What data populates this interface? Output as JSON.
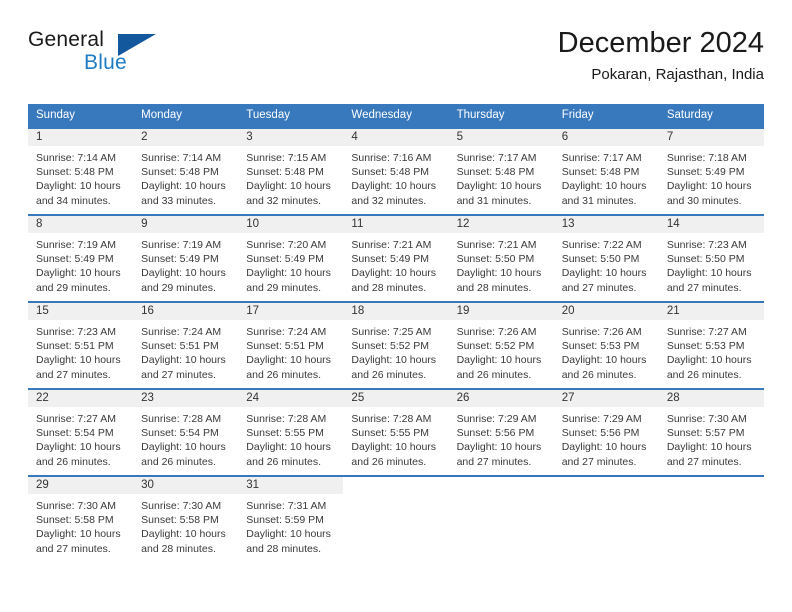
{
  "brand": {
    "word1": "General",
    "word2": "Blue",
    "flag_icon": "flag-triangle-icon",
    "blue_hex": "#1f7cc4",
    "dark_blue_hex": "#13589c"
  },
  "header": {
    "title": "December 2024",
    "subtitle": "Pokaran, Rajasthan, India"
  },
  "theme": {
    "header_blue": "#3878bd",
    "day_band_gray": "#f0f0f0",
    "text": "#3a3a3a"
  },
  "weekdays": [
    "Sunday",
    "Monday",
    "Tuesday",
    "Wednesday",
    "Thursday",
    "Friday",
    "Saturday"
  ],
  "weeks": [
    [
      {
        "day": "1",
        "sunrise": "Sunrise: 7:14 AM",
        "sunset": "Sunset: 5:48 PM",
        "daylight1": "Daylight: 10 hours",
        "daylight2": "and 34 minutes."
      },
      {
        "day": "2",
        "sunrise": "Sunrise: 7:14 AM",
        "sunset": "Sunset: 5:48 PM",
        "daylight1": "Daylight: 10 hours",
        "daylight2": "and 33 minutes."
      },
      {
        "day": "3",
        "sunrise": "Sunrise: 7:15 AM",
        "sunset": "Sunset: 5:48 PM",
        "daylight1": "Daylight: 10 hours",
        "daylight2": "and 32 minutes."
      },
      {
        "day": "4",
        "sunrise": "Sunrise: 7:16 AM",
        "sunset": "Sunset: 5:48 PM",
        "daylight1": "Daylight: 10 hours",
        "daylight2": "and 32 minutes."
      },
      {
        "day": "5",
        "sunrise": "Sunrise: 7:17 AM",
        "sunset": "Sunset: 5:48 PM",
        "daylight1": "Daylight: 10 hours",
        "daylight2": "and 31 minutes."
      },
      {
        "day": "6",
        "sunrise": "Sunrise: 7:17 AM",
        "sunset": "Sunset: 5:48 PM",
        "daylight1": "Daylight: 10 hours",
        "daylight2": "and 31 minutes."
      },
      {
        "day": "7",
        "sunrise": "Sunrise: 7:18 AM",
        "sunset": "Sunset: 5:49 PM",
        "daylight1": "Daylight: 10 hours",
        "daylight2": "and 30 minutes."
      }
    ],
    [
      {
        "day": "8",
        "sunrise": "Sunrise: 7:19 AM",
        "sunset": "Sunset: 5:49 PM",
        "daylight1": "Daylight: 10 hours",
        "daylight2": "and 29 minutes."
      },
      {
        "day": "9",
        "sunrise": "Sunrise: 7:19 AM",
        "sunset": "Sunset: 5:49 PM",
        "daylight1": "Daylight: 10 hours",
        "daylight2": "and 29 minutes."
      },
      {
        "day": "10",
        "sunrise": "Sunrise: 7:20 AM",
        "sunset": "Sunset: 5:49 PM",
        "daylight1": "Daylight: 10 hours",
        "daylight2": "and 29 minutes."
      },
      {
        "day": "11",
        "sunrise": "Sunrise: 7:21 AM",
        "sunset": "Sunset: 5:49 PM",
        "daylight1": "Daylight: 10 hours",
        "daylight2": "and 28 minutes."
      },
      {
        "day": "12",
        "sunrise": "Sunrise: 7:21 AM",
        "sunset": "Sunset: 5:50 PM",
        "daylight1": "Daylight: 10 hours",
        "daylight2": "and 28 minutes."
      },
      {
        "day": "13",
        "sunrise": "Sunrise: 7:22 AM",
        "sunset": "Sunset: 5:50 PM",
        "daylight1": "Daylight: 10 hours",
        "daylight2": "and 27 minutes."
      },
      {
        "day": "14",
        "sunrise": "Sunrise: 7:23 AM",
        "sunset": "Sunset: 5:50 PM",
        "daylight1": "Daylight: 10 hours",
        "daylight2": "and 27 minutes."
      }
    ],
    [
      {
        "day": "15",
        "sunrise": "Sunrise: 7:23 AM",
        "sunset": "Sunset: 5:51 PM",
        "daylight1": "Daylight: 10 hours",
        "daylight2": "and 27 minutes."
      },
      {
        "day": "16",
        "sunrise": "Sunrise: 7:24 AM",
        "sunset": "Sunset: 5:51 PM",
        "daylight1": "Daylight: 10 hours",
        "daylight2": "and 27 minutes."
      },
      {
        "day": "17",
        "sunrise": "Sunrise: 7:24 AM",
        "sunset": "Sunset: 5:51 PM",
        "daylight1": "Daylight: 10 hours",
        "daylight2": "and 26 minutes."
      },
      {
        "day": "18",
        "sunrise": "Sunrise: 7:25 AM",
        "sunset": "Sunset: 5:52 PM",
        "daylight1": "Daylight: 10 hours",
        "daylight2": "and 26 minutes."
      },
      {
        "day": "19",
        "sunrise": "Sunrise: 7:26 AM",
        "sunset": "Sunset: 5:52 PM",
        "daylight1": "Daylight: 10 hours",
        "daylight2": "and 26 minutes."
      },
      {
        "day": "20",
        "sunrise": "Sunrise: 7:26 AM",
        "sunset": "Sunset: 5:53 PM",
        "daylight1": "Daylight: 10 hours",
        "daylight2": "and 26 minutes."
      },
      {
        "day": "21",
        "sunrise": "Sunrise: 7:27 AM",
        "sunset": "Sunset: 5:53 PM",
        "daylight1": "Daylight: 10 hours",
        "daylight2": "and 26 minutes."
      }
    ],
    [
      {
        "day": "22",
        "sunrise": "Sunrise: 7:27 AM",
        "sunset": "Sunset: 5:54 PM",
        "daylight1": "Daylight: 10 hours",
        "daylight2": "and 26 minutes."
      },
      {
        "day": "23",
        "sunrise": "Sunrise: 7:28 AM",
        "sunset": "Sunset: 5:54 PM",
        "daylight1": "Daylight: 10 hours",
        "daylight2": "and 26 minutes."
      },
      {
        "day": "24",
        "sunrise": "Sunrise: 7:28 AM",
        "sunset": "Sunset: 5:55 PM",
        "daylight1": "Daylight: 10 hours",
        "daylight2": "and 26 minutes."
      },
      {
        "day": "25",
        "sunrise": "Sunrise: 7:28 AM",
        "sunset": "Sunset: 5:55 PM",
        "daylight1": "Daylight: 10 hours",
        "daylight2": "and 26 minutes."
      },
      {
        "day": "26",
        "sunrise": "Sunrise: 7:29 AM",
        "sunset": "Sunset: 5:56 PM",
        "daylight1": "Daylight: 10 hours",
        "daylight2": "and 27 minutes."
      },
      {
        "day": "27",
        "sunrise": "Sunrise: 7:29 AM",
        "sunset": "Sunset: 5:56 PM",
        "daylight1": "Daylight: 10 hours",
        "daylight2": "and 27 minutes."
      },
      {
        "day": "28",
        "sunrise": "Sunrise: 7:30 AM",
        "sunset": "Sunset: 5:57 PM",
        "daylight1": "Daylight: 10 hours",
        "daylight2": "and 27 minutes."
      }
    ],
    [
      {
        "day": "29",
        "sunrise": "Sunrise: 7:30 AM",
        "sunset": "Sunset: 5:58 PM",
        "daylight1": "Daylight: 10 hours",
        "daylight2": "and 27 minutes."
      },
      {
        "day": "30",
        "sunrise": "Sunrise: 7:30 AM",
        "sunset": "Sunset: 5:58 PM",
        "daylight1": "Daylight: 10 hours",
        "daylight2": "and 28 minutes."
      },
      {
        "day": "31",
        "sunrise": "Sunrise: 7:31 AM",
        "sunset": "Sunset: 5:59 PM",
        "daylight1": "Daylight: 10 hours",
        "daylight2": "and 28 minutes."
      },
      {
        "day": "",
        "sunrise": "",
        "sunset": "",
        "daylight1": "",
        "daylight2": ""
      },
      {
        "day": "",
        "sunrise": "",
        "sunset": "",
        "daylight1": "",
        "daylight2": ""
      },
      {
        "day": "",
        "sunrise": "",
        "sunset": "",
        "daylight1": "",
        "daylight2": ""
      },
      {
        "day": "",
        "sunrise": "",
        "sunset": "",
        "daylight1": "",
        "daylight2": ""
      }
    ]
  ]
}
